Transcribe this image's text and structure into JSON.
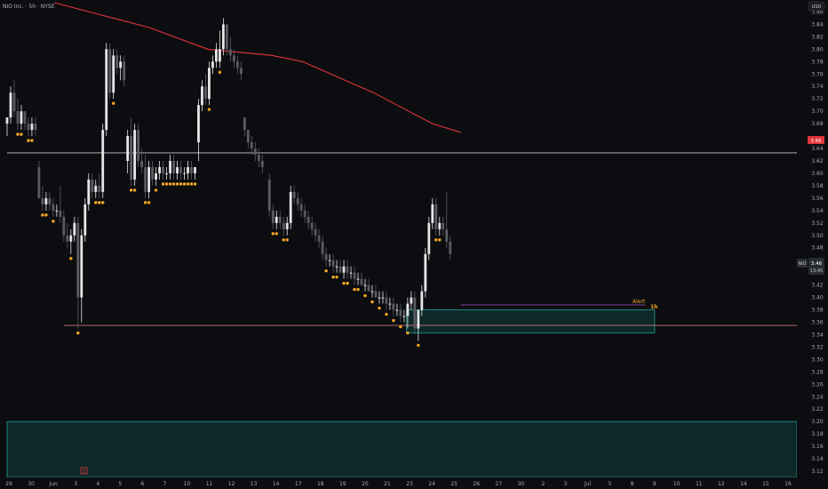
{
  "header": {
    "title": "NIO Inc. · 5h · NYSE",
    "currency": "USD"
  },
  "colors": {
    "background": "#0c0d10",
    "candle_up": "#e6e6e6",
    "candle_down": "#5a5c62",
    "ma_line": "#e0353c",
    "dots": "#f5a623",
    "zone": "#1aa59a",
    "level_line": "#c9c9c9",
    "support_line": "#f08a8a",
    "alert_line": "#8e44ad",
    "alert_text": "#f5a623",
    "price_badge": "#e0353c",
    "ticker_badge": "#2a2c33"
  },
  "price_axis": {
    "ticks": [
      "3.86",
      "3.84",
      "3.82",
      "3.80",
      "3.78",
      "3.76",
      "3.74",
      "3.72",
      "3.70",
      "3.68",
      "3.64",
      "3.62",
      "3.60",
      "3.58",
      "3.56",
      "3.54",
      "3.52",
      "3.50",
      "3.48",
      "3.44",
      "3.42",
      "3.40",
      "3.38",
      "3.36",
      "3.34",
      "3.32",
      "3.30",
      "3.28",
      "3.26",
      "3.24",
      "3.22",
      "3.20",
      "3.18",
      "3.16",
      "3.14",
      "3.12"
    ],
    "ma_label": "3.66",
    "ticker_label": "NIO",
    "last_price": "3.46",
    "countdown": "13:45"
  },
  "time_axis": {
    "labels": [
      "29",
      "30",
      "Jun",
      "3",
      "4",
      "5",
      "6",
      "7",
      "10",
      "11",
      "12",
      "13",
      "14",
      "17",
      "18",
      "19",
      "20",
      "21",
      "23",
      "24",
      "25",
      "26",
      "27",
      "30",
      "2",
      "3",
      "Jul",
      "5",
      "8",
      "9",
      "10",
      "11",
      "12",
      "14",
      "15",
      "16"
    ],
    "earnings_marker": "E"
  },
  "annotations": {
    "alert_text": "Alert",
    "interval_text": "1h"
  },
  "chart_data": {
    "type": "candlestick",
    "ylim": [
      3.11,
      3.875
    ],
    "overlay_ma": [
      {
        "x": 2.0,
        "y": 3.875
      },
      {
        "x": 6.0,
        "y": 3.835
      },
      {
        "x": 8.5,
        "y": 3.8
      },
      {
        "x": 11.2,
        "y": 3.79
      },
      {
        "x": 12.5,
        "y": 3.78
      },
      {
        "x": 14.0,
        "y": 3.755
      },
      {
        "x": 15.5,
        "y": 3.73
      },
      {
        "x": 17.0,
        "y": 3.7
      },
      {
        "x": 18.0,
        "y": 3.68
      },
      {
        "x": 19.2,
        "y": 3.666
      }
    ],
    "horizontal_levels": [
      {
        "name": "resistance",
        "y": 3.633,
        "x_start": 0.0,
        "x_end": 33.8
      },
      {
        "name": "support",
        "y": 3.355,
        "x_start": 2.4,
        "x_end": 33.8
      }
    ],
    "alert_level": {
      "y": 3.388,
      "x_start": 19.2,
      "x_end": 27.0
    },
    "zones": [
      {
        "name": "demand-small",
        "x_start": 16.9,
        "x_end": 27.4,
        "y_low": 3.343,
        "y_high": 3.38
      },
      {
        "name": "demand-large",
        "x_start": 0.0,
        "x_end": 33.8,
        "y_low": 3.11,
        "y_high": 3.2
      }
    ],
    "candles": [
      {
        "x": 0.0,
        "o": 3.68,
        "h": 3.69,
        "l": 3.66,
        "c": 3.69
      },
      {
        "x": 0.15,
        "o": 3.69,
        "h": 3.74,
        "l": 3.68,
        "c": 3.73
      },
      {
        "x": 0.3,
        "o": 3.73,
        "h": 3.75,
        "l": 3.69,
        "c": 3.7
      },
      {
        "x": 0.45,
        "o": 3.7,
        "h": 3.72,
        "l": 3.67,
        "c": 3.68
      },
      {
        "x": 0.6,
        "o": 3.68,
        "h": 3.71,
        "l": 3.67,
        "c": 3.7
      },
      {
        "x": 0.75,
        "o": 3.7,
        "h": 3.7,
        "l": 3.67,
        "c": 3.68
      },
      {
        "x": 0.9,
        "o": 3.68,
        "h": 3.69,
        "l": 3.66,
        "c": 3.67
      },
      {
        "x": 1.05,
        "o": 3.67,
        "h": 3.69,
        "l": 3.66,
        "c": 3.68
      },
      {
        "x": 1.2,
        "o": 3.68,
        "h": 3.69,
        "l": 3.66,
        "c": 3.67
      },
      {
        "x": 1.35,
        "o": 3.61,
        "h": 3.62,
        "l": 3.56,
        "c": 3.56
      },
      {
        "x": 1.5,
        "o": 3.56,
        "h": 3.58,
        "l": 3.54,
        "c": 3.55
      },
      {
        "x": 1.65,
        "o": 3.55,
        "h": 3.57,
        "l": 3.54,
        "c": 3.56
      },
      {
        "x": 1.8,
        "o": 3.56,
        "h": 3.57,
        "l": 3.54,
        "c": 3.55
      },
      {
        "x": 1.95,
        "o": 3.55,
        "h": 3.56,
        "l": 3.53,
        "c": 3.54
      },
      {
        "x": 2.1,
        "o": 3.54,
        "h": 3.55,
        "l": 3.53,
        "c": 3.54
      },
      {
        "x": 2.25,
        "o": 3.54,
        "h": 3.58,
        "l": 3.52,
        "c": 3.53
      },
      {
        "x": 2.4,
        "o": 3.53,
        "h": 3.54,
        "l": 3.49,
        "c": 3.5
      },
      {
        "x": 2.55,
        "o": 3.5,
        "h": 3.52,
        "l": 3.48,
        "c": 3.49
      },
      {
        "x": 2.7,
        "o": 3.49,
        "h": 3.51,
        "l": 3.47,
        "c": 3.5
      },
      {
        "x": 2.85,
        "o": 3.5,
        "h": 3.53,
        "l": 3.49,
        "c": 3.52
      },
      {
        "x": 3.0,
        "o": 3.52,
        "h": 3.53,
        "l": 3.35,
        "c": 3.4
      },
      {
        "x": 3.15,
        "o": 3.4,
        "h": 3.51,
        "l": 3.36,
        "c": 3.5
      },
      {
        "x": 3.3,
        "o": 3.5,
        "h": 3.56,
        "l": 3.49,
        "c": 3.55
      },
      {
        "x": 3.45,
        "o": 3.55,
        "h": 3.6,
        "l": 3.54,
        "c": 3.59
      },
      {
        "x": 3.6,
        "o": 3.59,
        "h": 3.6,
        "l": 3.56,
        "c": 3.57
      },
      {
        "x": 3.75,
        "o": 3.57,
        "h": 3.59,
        "l": 3.56,
        "c": 3.58
      },
      {
        "x": 3.9,
        "o": 3.58,
        "h": 3.6,
        "l": 3.56,
        "c": 3.57
      },
      {
        "x": 4.05,
        "o": 3.57,
        "h": 3.68,
        "l": 3.56,
        "c": 3.67
      },
      {
        "x": 4.2,
        "o": 3.67,
        "h": 3.81,
        "l": 3.66,
        "c": 3.8
      },
      {
        "x": 4.35,
        "o": 3.8,
        "h": 3.81,
        "l": 3.72,
        "c": 3.73
      },
      {
        "x": 4.5,
        "o": 3.73,
        "h": 3.8,
        "l": 3.72,
        "c": 3.79
      },
      {
        "x": 4.65,
        "o": 3.79,
        "h": 3.8,
        "l": 3.76,
        "c": 3.77
      },
      {
        "x": 4.8,
        "o": 3.77,
        "h": 3.79,
        "l": 3.75,
        "c": 3.78
      },
      {
        "x": 4.95,
        "o": 3.78,
        "h": 3.79,
        "l": 3.74,
        "c": 3.75
      },
      {
        "x": 5.1,
        "o": 3.62,
        "h": 3.67,
        "l": 3.6,
        "c": 3.66
      },
      {
        "x": 5.25,
        "o": 3.66,
        "h": 3.69,
        "l": 3.58,
        "c": 3.59
      },
      {
        "x": 5.4,
        "o": 3.59,
        "h": 3.68,
        "l": 3.58,
        "c": 3.67
      },
      {
        "x": 5.55,
        "o": 3.67,
        "h": 3.68,
        "l": 3.61,
        "c": 3.62
      },
      {
        "x": 5.7,
        "o": 3.62,
        "h": 3.64,
        "l": 3.6,
        "c": 3.61
      },
      {
        "x": 5.85,
        "o": 3.61,
        "h": 3.63,
        "l": 3.56,
        "c": 3.57
      },
      {
        "x": 6.0,
        "o": 3.57,
        "h": 3.62,
        "l": 3.56,
        "c": 3.61
      },
      {
        "x": 6.15,
        "o": 3.61,
        "h": 3.62,
        "l": 3.58,
        "c": 3.59
      },
      {
        "x": 6.3,
        "o": 3.59,
        "h": 3.61,
        "l": 3.58,
        "c": 3.6
      },
      {
        "x": 6.45,
        "o": 3.6,
        "h": 3.62,
        "l": 3.59,
        "c": 3.61
      },
      {
        "x": 6.6,
        "o": 3.61,
        "h": 3.62,
        "l": 3.59,
        "c": 3.6
      },
      {
        "x": 6.75,
        "o": 3.6,
        "h": 3.61,
        "l": 3.59,
        "c": 3.6
      },
      {
        "x": 6.9,
        "o": 3.6,
        "h": 3.63,
        "l": 3.59,
        "c": 3.62
      },
      {
        "x": 7.05,
        "o": 3.62,
        "h": 3.63,
        "l": 3.59,
        "c": 3.6
      },
      {
        "x": 7.2,
        "o": 3.6,
        "h": 3.62,
        "l": 3.59,
        "c": 3.61
      },
      {
        "x": 7.35,
        "o": 3.61,
        "h": 3.62,
        "l": 3.59,
        "c": 3.6
      },
      {
        "x": 7.5,
        "o": 3.6,
        "h": 3.61,
        "l": 3.59,
        "c": 3.6
      },
      {
        "x": 7.65,
        "o": 3.6,
        "h": 3.62,
        "l": 3.59,
        "c": 3.61
      },
      {
        "x": 7.8,
        "o": 3.61,
        "h": 3.62,
        "l": 3.59,
        "c": 3.6
      },
      {
        "x": 7.95,
        "o": 3.6,
        "h": 3.61,
        "l": 3.59,
        "c": 3.61
      },
      {
        "x": 8.1,
        "o": 3.65,
        "h": 3.72,
        "l": 3.62,
        "c": 3.71
      },
      {
        "x": 8.25,
        "o": 3.71,
        "h": 3.75,
        "l": 3.7,
        "c": 3.74
      },
      {
        "x": 8.4,
        "o": 3.74,
        "h": 3.76,
        "l": 3.71,
        "c": 3.72
      },
      {
        "x": 8.55,
        "o": 3.72,
        "h": 3.78,
        "l": 3.71,
        "c": 3.77
      },
      {
        "x": 8.7,
        "o": 3.77,
        "h": 3.79,
        "l": 3.76,
        "c": 3.78
      },
      {
        "x": 8.85,
        "o": 3.78,
        "h": 3.81,
        "l": 3.77,
        "c": 3.8
      },
      {
        "x": 9.0,
        "o": 3.78,
        "h": 3.83,
        "l": 3.77,
        "c": 3.8
      },
      {
        "x": 9.15,
        "o": 3.8,
        "h": 3.85,
        "l": 3.79,
        "c": 3.84
      },
      {
        "x": 9.3,
        "o": 3.84,
        "h": 3.84,
        "l": 3.79,
        "c": 3.8
      },
      {
        "x": 9.45,
        "o": 3.8,
        "h": 3.82,
        "l": 3.78,
        "c": 3.79
      },
      {
        "x": 9.6,
        "o": 3.79,
        "h": 3.8,
        "l": 3.77,
        "c": 3.78
      },
      {
        "x": 9.75,
        "o": 3.78,
        "h": 3.79,
        "l": 3.76,
        "c": 3.77
      },
      {
        "x": 9.9,
        "o": 3.77,
        "h": 3.78,
        "l": 3.75,
        "c": 3.76
      },
      {
        "x": 10.05,
        "o": 3.69,
        "h": 3.69,
        "l": 3.66,
        "c": 3.67
      },
      {
        "x": 10.2,
        "o": 3.67,
        "h": 3.67,
        "l": 3.64,
        "c": 3.65
      },
      {
        "x": 10.35,
        "o": 3.65,
        "h": 3.66,
        "l": 3.63,
        "c": 3.64
      },
      {
        "x": 10.5,
        "o": 3.64,
        "h": 3.65,
        "l": 3.62,
        "c": 3.63
      },
      {
        "x": 10.65,
        "o": 3.63,
        "h": 3.64,
        "l": 3.61,
        "c": 3.62
      },
      {
        "x": 10.8,
        "o": 3.62,
        "h": 3.63,
        "l": 3.6,
        "c": 3.61
      },
      {
        "x": 11.1,
        "o": 3.59,
        "h": 3.6,
        "l": 3.53,
        "c": 3.54
      },
      {
        "x": 11.25,
        "o": 3.54,
        "h": 3.55,
        "l": 3.51,
        "c": 3.52
      },
      {
        "x": 11.4,
        "o": 3.52,
        "h": 3.54,
        "l": 3.51,
        "c": 3.53
      },
      {
        "x": 11.55,
        "o": 3.53,
        "h": 3.54,
        "l": 3.51,
        "c": 3.52
      },
      {
        "x": 11.7,
        "o": 3.52,
        "h": 3.53,
        "l": 3.5,
        "c": 3.51
      },
      {
        "x": 11.85,
        "o": 3.51,
        "h": 3.53,
        "l": 3.5,
        "c": 3.52
      },
      {
        "x": 12.0,
        "o": 3.52,
        "h": 3.58,
        "l": 3.51,
        "c": 3.57
      },
      {
        "x": 12.15,
        "o": 3.57,
        "h": 3.58,
        "l": 3.55,
        "c": 3.56
      },
      {
        "x": 12.3,
        "o": 3.56,
        "h": 3.57,
        "l": 3.54,
        "c": 3.55
      },
      {
        "x": 12.45,
        "o": 3.55,
        "h": 3.56,
        "l": 3.53,
        "c": 3.54
      },
      {
        "x": 12.6,
        "o": 3.54,
        "h": 3.55,
        "l": 3.52,
        "c": 3.53
      },
      {
        "x": 12.75,
        "o": 3.53,
        "h": 3.54,
        "l": 3.51,
        "c": 3.52
      },
      {
        "x": 12.9,
        "o": 3.52,
        "h": 3.53,
        "l": 3.5,
        "c": 3.51
      },
      {
        "x": 13.05,
        "o": 3.51,
        "h": 3.52,
        "l": 3.49,
        "c": 3.5
      },
      {
        "x": 13.2,
        "o": 3.5,
        "h": 3.51,
        "l": 3.48,
        "c": 3.49
      },
      {
        "x": 13.35,
        "o": 3.49,
        "h": 3.5,
        "l": 3.46,
        "c": 3.47
      },
      {
        "x": 13.5,
        "o": 3.47,
        "h": 3.48,
        "l": 3.45,
        "c": 3.46
      },
      {
        "x": 13.65,
        "o": 3.46,
        "h": 3.47,
        "l": 3.45,
        "c": 3.46
      },
      {
        "x": 13.8,
        "o": 3.46,
        "h": 3.47,
        "l": 3.44,
        "c": 3.45
      },
      {
        "x": 13.95,
        "o": 3.45,
        "h": 3.46,
        "l": 3.44,
        "c": 3.45
      },
      {
        "x": 14.1,
        "o": 3.45,
        "h": 3.46,
        "l": 3.44,
        "c": 3.44
      },
      {
        "x": 14.25,
        "o": 3.44,
        "h": 3.46,
        "l": 3.43,
        "c": 3.45
      },
      {
        "x": 14.4,
        "o": 3.45,
        "h": 3.46,
        "l": 3.43,
        "c": 3.44
      },
      {
        "x": 14.55,
        "o": 3.44,
        "h": 3.45,
        "l": 3.43,
        "c": 3.44
      },
      {
        "x": 14.7,
        "o": 3.44,
        "h": 3.45,
        "l": 3.42,
        "c": 3.43
      },
      {
        "x": 14.85,
        "o": 3.43,
        "h": 3.44,
        "l": 3.42,
        "c": 3.43
      },
      {
        "x": 15.0,
        "o": 3.43,
        "h": 3.44,
        "l": 3.42,
        "c": 3.42
      },
      {
        "x": 15.15,
        "o": 3.42,
        "h": 3.43,
        "l": 3.41,
        "c": 3.42
      },
      {
        "x": 15.3,
        "o": 3.42,
        "h": 3.43,
        "l": 3.41,
        "c": 3.41
      },
      {
        "x": 15.45,
        "o": 3.41,
        "h": 3.42,
        "l": 3.4,
        "c": 3.41
      },
      {
        "x": 15.6,
        "o": 3.41,
        "h": 3.42,
        "l": 3.4,
        "c": 3.4
      },
      {
        "x": 15.75,
        "o": 3.4,
        "h": 3.41,
        "l": 3.39,
        "c": 3.4
      },
      {
        "x": 15.9,
        "o": 3.4,
        "h": 3.41,
        "l": 3.39,
        "c": 3.4
      },
      {
        "x": 16.05,
        "o": 3.4,
        "h": 3.41,
        "l": 3.38,
        "c": 3.39
      },
      {
        "x": 16.2,
        "o": 3.39,
        "h": 3.4,
        "l": 3.38,
        "c": 3.39
      },
      {
        "x": 16.35,
        "o": 3.39,
        "h": 3.4,
        "l": 3.37,
        "c": 3.38
      },
      {
        "x": 16.5,
        "o": 3.38,
        "h": 3.39,
        "l": 3.37,
        "c": 3.38
      },
      {
        "x": 16.65,
        "o": 3.38,
        "h": 3.39,
        "l": 3.36,
        "c": 3.37
      },
      {
        "x": 16.8,
        "o": 3.37,
        "h": 3.38,
        "l": 3.36,
        "c": 3.37
      },
      {
        "x": 16.95,
        "o": 3.37,
        "h": 3.4,
        "l": 3.35,
        "c": 3.39
      },
      {
        "x": 17.1,
        "o": 3.39,
        "h": 3.41,
        "l": 3.38,
        "c": 3.4
      },
      {
        "x": 17.25,
        "o": 3.4,
        "h": 3.41,
        "l": 3.34,
        "c": 3.35
      },
      {
        "x": 17.4,
        "o": 3.35,
        "h": 3.38,
        "l": 3.33,
        "c": 3.38
      },
      {
        "x": 17.55,
        "o": 3.38,
        "h": 3.42,
        "l": 3.37,
        "c": 3.41
      },
      {
        "x": 17.7,
        "o": 3.41,
        "h": 3.48,
        "l": 3.4,
        "c": 3.47
      },
      {
        "x": 17.85,
        "o": 3.47,
        "h": 3.53,
        "l": 3.46,
        "c": 3.52
      },
      {
        "x": 18.0,
        "o": 3.52,
        "h": 3.56,
        "l": 3.51,
        "c": 3.55
      },
      {
        "x": 18.15,
        "o": 3.55,
        "h": 3.56,
        "l": 3.5,
        "c": 3.51
      },
      {
        "x": 18.3,
        "o": 3.51,
        "h": 3.53,
        "l": 3.5,
        "c": 3.52
      },
      {
        "x": 18.45,
        "o": 3.52,
        "h": 3.53,
        "l": 3.5,
        "c": 3.51
      },
      {
        "x": 18.6,
        "o": 3.51,
        "h": 3.57,
        "l": 3.48,
        "c": 3.49
      },
      {
        "x": 18.75,
        "o": 3.49,
        "h": 3.5,
        "l": 3.46,
        "c": 3.47
      }
    ]
  }
}
